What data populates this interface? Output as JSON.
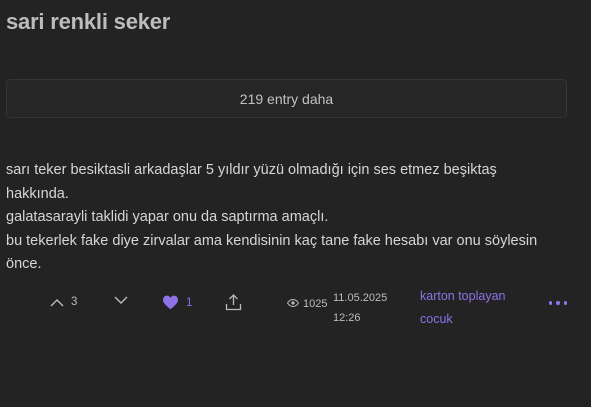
{
  "topic": {
    "title": "sari renkli seker"
  },
  "more_entries": {
    "label": "219 entry daha"
  },
  "entry": {
    "lines": [
      "sarı teker besiktasli arkadaşlar 5 yıldır yüzü olmadığı için ses etmez beşiktaş hakkında.",
      "galatasarayli taklidi yapar onu da saptırma amaçlı.",
      "bu tekerlek fake diye zirvalar ama kendisinin kaç tane fake hesabı var onu söylesin önce."
    ],
    "upvotes": "3",
    "favorites": "1",
    "views": "1025",
    "date": "11.05.2025",
    "time": "12:26",
    "author_line1": "karton toplayan",
    "author_line2": "cocuk"
  },
  "colors": {
    "background": "#232323",
    "accent": "#8f72e8",
    "text": "#d6d6d6"
  },
  "icons": {
    "upvote": "chevron-up-icon",
    "downvote": "chevron-down-icon",
    "favorite": "heart-icon",
    "share": "share-icon",
    "views": "eye-icon",
    "more": "more-dots-icon"
  }
}
